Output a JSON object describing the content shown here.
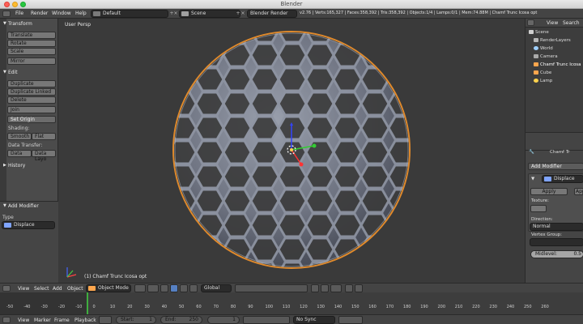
{
  "window": {
    "title": "Blender"
  },
  "info_header": {
    "menus": [
      "File",
      "Render",
      "Window",
      "Help"
    ],
    "screen_layout": "Default",
    "scene": "Scene",
    "render_engine": "Blender Render",
    "stats": "v2.76 | Verts:165,327 | Faces:358,392 | Tris:358,392 | Objects:1/4 | Lamps:0/1 | Mem:74.88M | Chamf Trunc Icosa opt"
  },
  "tool_shelf": {
    "transform": {
      "title": "Transform",
      "buttons": [
        "Translate",
        "Rotate",
        "Scale",
        "Mirror"
      ]
    },
    "edit": {
      "title": "Edit",
      "buttons": [
        "Duplicate",
        "Duplicate Linked",
        "Delete",
        "Join"
      ],
      "set_origin": "Set Origin"
    },
    "shading": {
      "label": "Shading:",
      "smooth": "Smooth",
      "flat": "Flat"
    },
    "data_transfer": {
      "label": "Data Transfer:",
      "data": "Data",
      "data_layout": "Data Layo"
    },
    "history": {
      "title": "History"
    }
  },
  "last_operator": {
    "title": "Add Modifier",
    "type_label": "Type",
    "type_value": "Displace"
  },
  "viewport": {
    "view_label": "User Persp",
    "object_label": "(1) Chamf Trunc Icosa opt"
  },
  "outliner": {
    "view": "View",
    "search": "Search",
    "items": [
      {
        "label": "Scene",
        "color": "#cfcfcf"
      },
      {
        "label": "RenderLayers",
        "color": "#b8b8b8"
      },
      {
        "label": "World",
        "color": "#9fd0ff"
      },
      {
        "label": "Camera",
        "color": "#aaaaaa"
      },
      {
        "label": "Chamf Trunc Icosa",
        "color": "#ffa64d"
      },
      {
        "label": "Cube",
        "color": "#ffa64d"
      },
      {
        "label": "Lamp",
        "color": "#ffd24d"
      }
    ]
  },
  "properties": {
    "object_name": "Chamf Tr",
    "add_modifier": "Add Modifier",
    "modifier_name": "Displace",
    "apply": "Apply",
    "apply_as": "App",
    "texture_label": "Texture:",
    "direction_label": "Direction:",
    "direction_value": "Normal",
    "vertex_group_label": "Vertex Group:",
    "midlevel_label": "Midlevel:",
    "midlevel_value": "0.5"
  },
  "view3d_header": {
    "menus": [
      "View",
      "Select",
      "Add",
      "Object"
    ],
    "mode": "Object Mode",
    "orientation": "Global"
  },
  "timeline": {
    "ticks": [
      "-50",
      "-40",
      "-30",
      "-20",
      "-10",
      "0",
      "10",
      "20",
      "30",
      "40",
      "50",
      "60",
      "70",
      "80",
      "90",
      "100",
      "110",
      "120",
      "130",
      "140",
      "150",
      "160",
      "170",
      "180",
      "190",
      "200",
      "210",
      "220",
      "230",
      "240",
      "250",
      "260"
    ]
  },
  "timeline_controls": {
    "menus": [
      "View",
      "Marker",
      "Frame",
      "Playback"
    ],
    "start_label": "Start:",
    "start_value": "1",
    "end_label": "End:",
    "end_value": "250",
    "current_frame": "1",
    "sync": "No Sync"
  }
}
